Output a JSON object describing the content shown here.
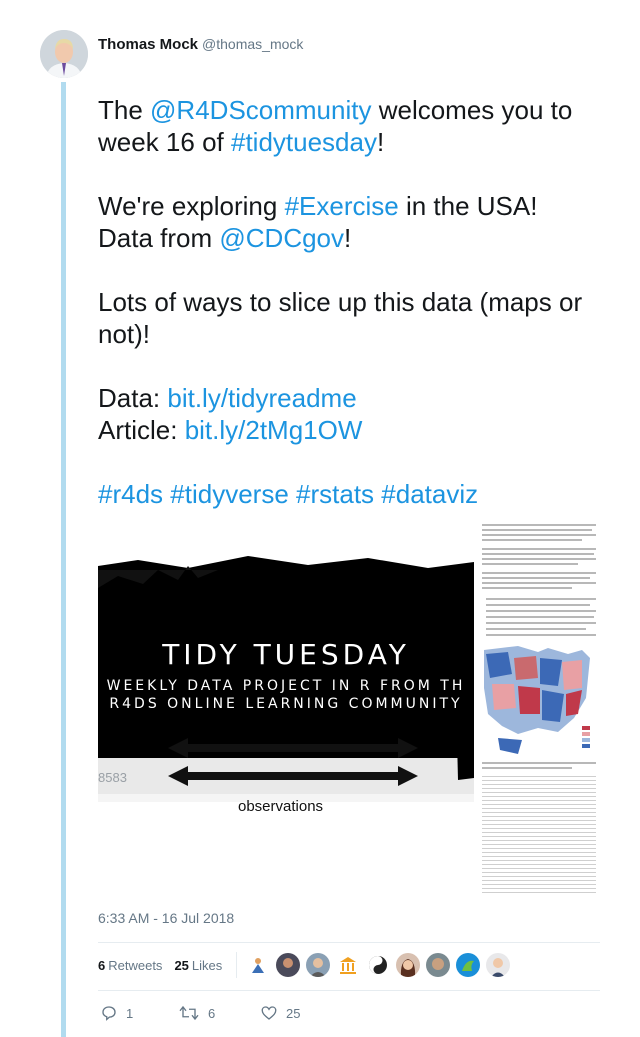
{
  "author": {
    "name": "Thomas Mock",
    "handle": "@thomas_mock"
  },
  "tweet": {
    "lines": [
      [
        {
          "t": "The "
        },
        {
          "t": "@R4DScommunity",
          "link": true
        },
        {
          "t": " welcomes you to"
        }
      ],
      [
        {
          "t": "week 16 of "
        },
        {
          "t": "#tidytuesday",
          "link": true
        },
        {
          "t": "!"
        }
      ],
      [],
      [
        {
          "t": "We're exploring "
        },
        {
          "t": "#Exercise",
          "link": true
        },
        {
          "t": " in the USA!"
        }
      ],
      [
        {
          "t": "Data from "
        },
        {
          "t": "@CDCgov",
          "link": true
        },
        {
          "t": "!"
        }
      ],
      [],
      [
        {
          "t": "Lots of ways to slice up this data (maps or"
        }
      ],
      [
        {
          "t": "not)!"
        }
      ],
      [],
      [
        {
          "t": "Data: "
        },
        {
          "t": "bit.ly/tidyreadme",
          "link": true
        }
      ],
      [
        {
          "t": "Article: "
        },
        {
          "t": "bit.ly/2tMg1OW",
          "link": true
        }
      ],
      [],
      [
        {
          "t": "#r4ds",
          "link": true
        },
        {
          "t": " "
        },
        {
          "t": "#tidyverse",
          "link": true
        },
        {
          "t": " "
        },
        {
          "t": "#rstats",
          "link": true
        },
        {
          "t": " "
        },
        {
          "t": "#dataviz",
          "link": true
        }
      ]
    ]
  },
  "media": {
    "left": {
      "title": "TIDY TUESDAY",
      "subtitle_line1": "WEEKLY DATA PROJECT IN R FROM TH",
      "subtitle_line2": "R4DS ONLINE LEARNING COMMUNITY",
      "observations_label": "observations",
      "row_number": "8583"
    }
  },
  "timestamp": "6:33 AM - 16 Jul 2018",
  "stats": {
    "retweets_count": "6",
    "retweets_label": "Retweets",
    "likes_count": "25",
    "likes_label": "Likes"
  },
  "actions": {
    "reply_count": "1",
    "retweet_count": "6",
    "like_count": "25"
  },
  "colors": {
    "link": "#1c94e0",
    "thread_line": "#b1dbef",
    "muted": "#657786"
  }
}
